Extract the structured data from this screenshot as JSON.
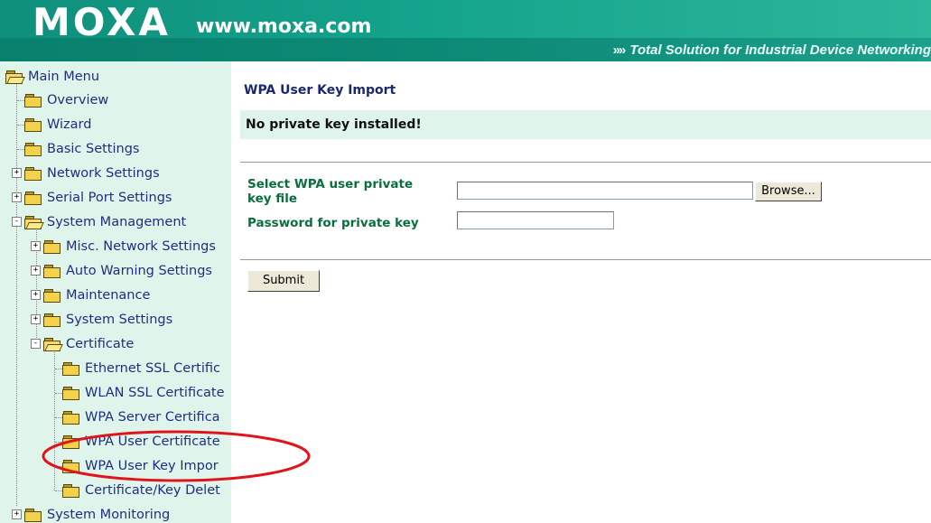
{
  "header": {
    "logo": "MOXA",
    "website": "www.moxa.com",
    "tagline_arrows": "»»",
    "tagline": "Total Solution for Industrial Device Networking"
  },
  "sidebar": {
    "items": [
      {
        "label": "Main Menu",
        "icon": "open-folder-icon"
      },
      {
        "label": "Overview",
        "icon": "folder-icon"
      },
      {
        "label": "Wizard",
        "icon": "folder-icon"
      },
      {
        "label": "Basic Settings",
        "icon": "folder-icon"
      },
      {
        "label": "Network Settings",
        "icon": "folder-icon",
        "expander": "+"
      },
      {
        "label": "Serial Port Settings",
        "icon": "folder-icon",
        "expander": "+"
      },
      {
        "label": "System Management",
        "icon": "open-folder-icon",
        "expander": "-"
      },
      {
        "label": "Misc. Network Settings",
        "icon": "folder-icon",
        "expander": "+"
      },
      {
        "label": "Auto Warning Settings",
        "icon": "folder-icon",
        "expander": "+"
      },
      {
        "label": "Maintenance",
        "icon": "folder-icon",
        "expander": "+"
      },
      {
        "label": "System Settings",
        "icon": "folder-icon",
        "expander": "+"
      },
      {
        "label": "Certificate",
        "icon": "open-folder-icon",
        "expander": "-"
      },
      {
        "label": "Ethernet SSL Certific",
        "icon": "folder-icon"
      },
      {
        "label": "WLAN SSL Certificate",
        "icon": "folder-icon"
      },
      {
        "label": "WPA Server Certifica",
        "icon": "folder-icon"
      },
      {
        "label": "WPA User Certificate",
        "icon": "folder-icon"
      },
      {
        "label": "WPA User Key Impor",
        "icon": "folder-icon"
      },
      {
        "label": "Certificate/Key Delet",
        "icon": "folder-icon"
      },
      {
        "label": "System Monitoring",
        "icon": "folder-icon",
        "expander": "+"
      }
    ]
  },
  "main": {
    "title": "WPA User Key Import",
    "notice": "No private key installed!",
    "form": {
      "key_file_label": "Select WPA user private key file",
      "key_file_value": "",
      "browse_label": "Browse...",
      "password_label": "Password for private key",
      "password_value": "",
      "submit_label": "Submit"
    }
  },
  "colors": {
    "header_green": "#14a38c",
    "sidebar_bg": "#dff5ec",
    "nav_text": "#1e2f80",
    "label_green": "#0b6e3f",
    "annotation_red": "#e0141b"
  }
}
